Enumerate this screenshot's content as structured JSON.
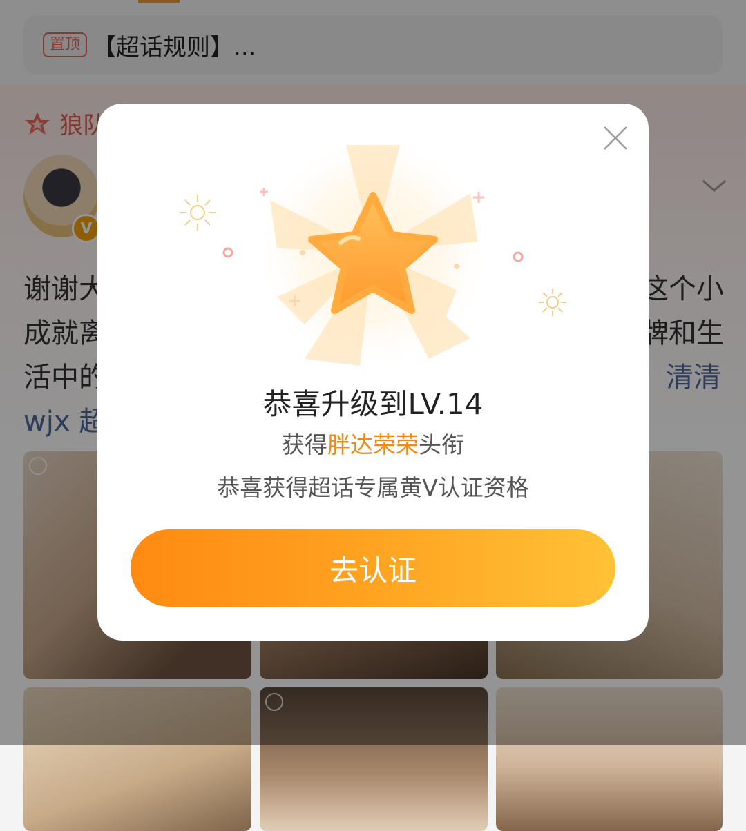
{
  "background": {
    "pinned": {
      "badge": "置顶",
      "text": "【超话规则】..."
    },
    "group": {
      "name_visible": "狼队"
    },
    "post_lines": [
      {
        "left": "谢谢大",
        "right": "这个小"
      },
      {
        "left": "成就离",
        "right": "牌和生"
      },
      {
        "left": "活中的",
        "right": "清清"
      },
      {
        "left": "wjx 超",
        "right": ""
      }
    ]
  },
  "dialog": {
    "title": "恭喜升级到LV.14",
    "title_line_prefix": "获得",
    "title_line_highlight": "胖达荣荣",
    "title_line_suffix": "头衔",
    "subtitle": "恭喜获得超话专属黄V认证资格",
    "cta_label": "去认证",
    "accent_color": "#f08a12",
    "star_icon": "star-icon",
    "close_icon": "close-icon"
  }
}
